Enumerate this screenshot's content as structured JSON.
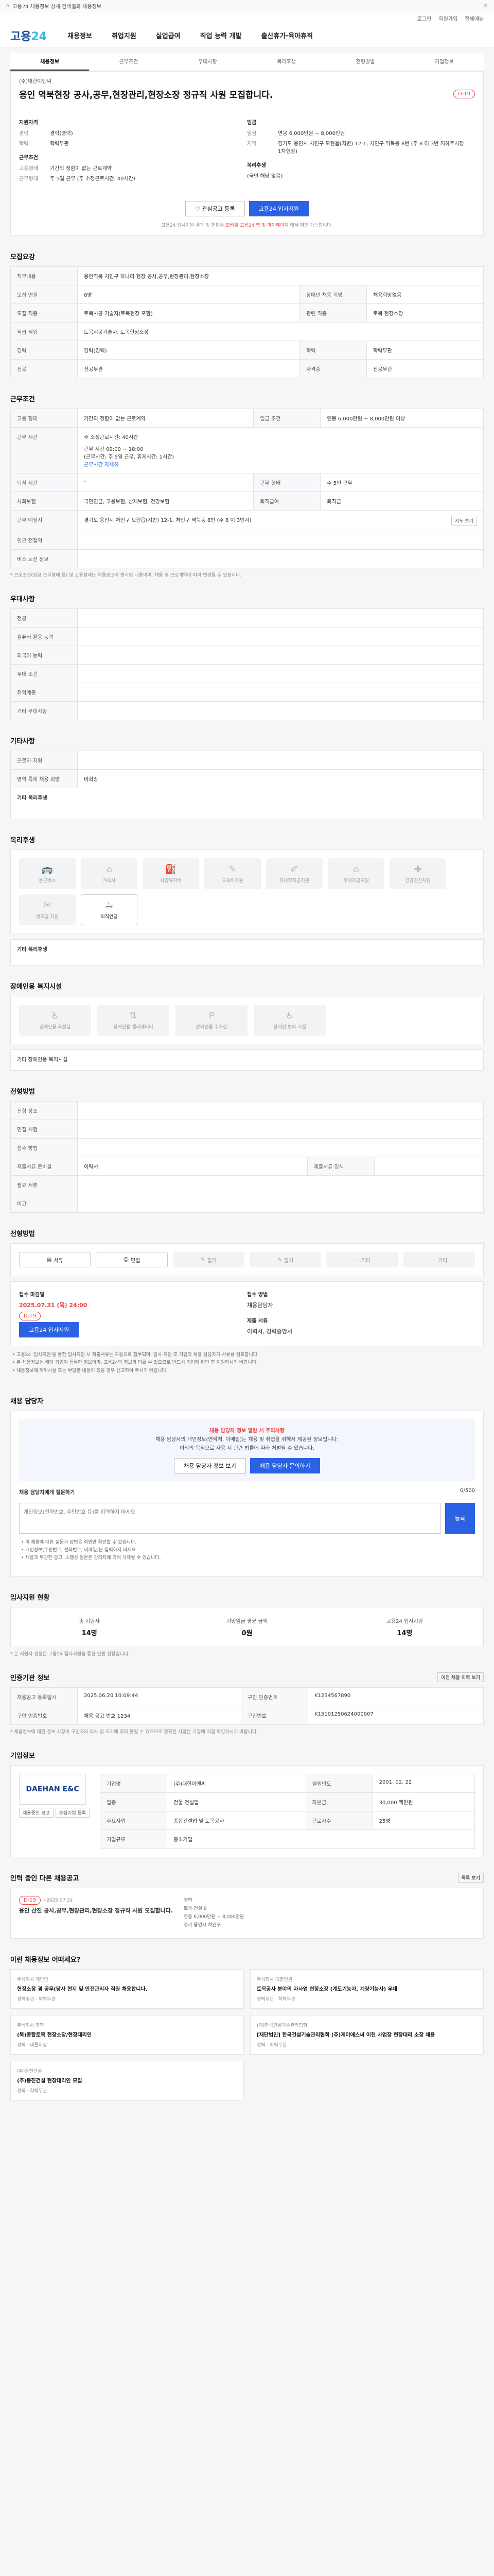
{
  "topbar": {
    "title": "고용24 채용정보 상세 검색결과 채용정보"
  },
  "util": {
    "links": [
      "로그인",
      "회원가입",
      "전체메뉴"
    ]
  },
  "header": {
    "logo_a": "고용",
    "logo_b": "24",
    "nav": [
      "채용정보",
      "취업지원",
      "실업급여",
      "직업 능력 개발",
      "출산휴가·육아휴직"
    ]
  },
  "tabs": [
    "채용정보",
    "근무조건",
    "우대사항",
    "복리후생",
    "전형방법",
    "기업정보"
  ],
  "job": {
    "company": "(주)대한이엔씨",
    "title": "용인 역북현장 공사,공무,현장관리,현장소장 정규직 사원 모집합니다.",
    "dday": "D-19",
    "qual_h": "지원자격",
    "qual": [
      {
        "k": "경력",
        "v": "경력(경력)"
      },
      {
        "k": "학력",
        "v": "학력무관"
      }
    ],
    "cond_h": "근무조건",
    "cond": [
      {
        "k": "고용형태",
        "v": "기간의 정함이 없는 근로계약"
      },
      {
        "k": "근무형태",
        "v": "주 5일 근무 (주 소정근로시간: 40시간)"
      }
    ],
    "pay_h": "임금",
    "pay": [
      {
        "k": "임금",
        "v": "연봉 6,000만원 ~ 8,000만원"
      },
      {
        "k": "지역",
        "v": "경기도 용인시 처인구 모현읍(지번) 12-1, 처인구 역북동 8번 (주 8 이 3번 지하주차장1차현장)"
      }
    ],
    "welfare_h": "복리후생",
    "welfare": "(국민 해당 없음)",
    "scrap": "♡ 관심공고 등록",
    "apply": "고용24 입사지원",
    "notice_a": "고용24 입사지원 결과 및 현황은",
    "notice_red": "모바일 고용24 앱 및 마이페이지",
    "notice_b": "에서 확인 가능합니다."
  },
  "sec": {
    "recruit": "모집요강",
    "cond": "근무조건",
    "pref": "우대사항",
    "etc": "기타사항",
    "welfare": "복리후생",
    "accessible": "장애인용 복지시설",
    "process": "전형방법",
    "contact": "채용 담당자",
    "stats": "입사지원 현황",
    "info": "인증기관 정보",
    "company": "기업정보",
    "related": "인력 중인 다른 채용공고",
    "recs": "이런 채용정보 어떠세요?"
  },
  "recruit": {
    "duty_h": "직무내용",
    "duty": "용인역북 처인구 하나리 현장 공사,공무,현장관리,현장소장",
    "rows": [
      {
        "k": "모집 인원",
        "v": "0명",
        "k2": "장애인 채용 희망",
        "v2": "채용희망없음"
      },
      {
        "k": "모집 직종",
        "v": "토목시공 기술자(토목현장 포함)",
        "k2": "관련 직종",
        "v2": "토목 현장소장"
      },
      {
        "k": "직급 직위",
        "v": "토목시공기술자, 토목현장소장",
        "k2": "",
        "v2": ""
      },
      {
        "k": "경력",
        "v": "경력(경력)",
        "k2": "학력",
        "v2": "학력무관"
      },
      {
        "k": "전공",
        "v": "전공무관",
        "k2": "자격증",
        "v2": "전공무관"
      }
    ]
  },
  "cond": {
    "rows1": [
      {
        "k": "고용 형태",
        "v": "기간의 정함이 없는 근로계약",
        "k2": "임금 조건",
        "v2": "연봉 6,000만원 ~ 8,000만원 이상"
      },
      {
        "k": "근무 시간",
        "v": "주 소정근로시간: 40시간",
        "k2": "",
        "v2": ""
      }
    ],
    "worktime_a": "근무 시간 09:00 ~ 18:00",
    "worktime_b": "(근무시간: 주 5일 근무, 휴게시간: 1시간)",
    "worktime_link": "근무시간 자세히",
    "rows2": [
      {
        "k": "퇴직 시간",
        "v": "-",
        "k2": "근무 형태",
        "v2": "주 5일 근무"
      },
      {
        "k": "사회보험",
        "v": "국민연금, 고용보험, 산재보험, 건강보험",
        "k2": "퇴직급여",
        "v2": "퇴직금"
      },
      {
        "k": "근무 예정지",
        "v": "경기도 용인시 처인구 모현읍(지번) 12-1, 처인구 역북동 8번 (주 8 이 3번지)",
        "k2": "",
        "v2": ""
      },
      {
        "k": "인근 전철역",
        "v": "",
        "k2": "",
        "v2": ""
      },
      {
        "k": "버스 노선 정보",
        "v": "",
        "k2": "",
        "v2": ""
      }
    ],
    "map_btn": "지도 보기",
    "note": "* 근로조건(임금 근무형태 등) 및 고용형태는 채용공고에 명시된 내용이며, 채용 후 근로계약에 따라 변경될 수 있습니다."
  },
  "pref": {
    "rows": [
      {
        "k": "전공",
        "v": ""
      },
      {
        "k": "컴퓨터 활용 능력",
        "v": ""
      },
      {
        "k": "외국어 능력",
        "v": ""
      },
      {
        "k": "우대 조건",
        "v": ""
      },
      {
        "k": "취약계층",
        "v": ""
      },
      {
        "k": "기타 우대사항",
        "v": ""
      }
    ]
  },
  "etc": {
    "rows": [
      {
        "k": "근로자 지원",
        "v": ""
      },
      {
        "k": "병역 특례 채용 희망",
        "v": "비희망"
      }
    ],
    "more_h": "기타 복리후생"
  },
  "welfare": {
    "items": [
      "통근버스",
      "기숙사",
      "차량유지비",
      "교육비지원",
      "자녀학자금지원",
      "주택자금지원",
      "건강검진지원",
      "경조금 지원",
      "퇴직연금"
    ],
    "on_index": 8,
    "more_h": "기타 복리후생"
  },
  "accessible": {
    "items": [
      "장애인용 화장실",
      "장애인용 엘리베이터",
      "장애인용 주차장",
      "장애인 편의 시설"
    ],
    "note": "기타 장애인용 복지시설"
  },
  "process": {
    "rows": [
      {
        "k": "전형 장소",
        "v": "",
        "k2": "",
        "v2": ""
      },
      {
        "k": "면접 시험",
        "v": "",
        "k2": "",
        "v2": ""
      },
      {
        "k": "접수 방법",
        "v": "",
        "k2": "",
        "v2": ""
      },
      {
        "k": "제출서류 준비물",
        "v": "이력서",
        "k2": "제출서류 양식",
        "v2": ""
      },
      {
        "k": "필요 서류",
        "v": "",
        "k2": "",
        "v2": ""
      },
      {
        "k": "비고",
        "v": "",
        "k2": "",
        "v2": ""
      }
    ]
  },
  "method": {
    "items": [
      "서류",
      "면접",
      "필기",
      "필기",
      "기타",
      "기타"
    ],
    "apply_h": "접수 마감일",
    "apply_date": "2025.07.31 (목) 24:00",
    "apply_dday": "D-19",
    "apply_btn": "고용24 입사지원",
    "how_h": "접수 방법",
    "how": "채용담당자",
    "docs_h": "제출 서류",
    "docs": "이력서, 경력증명서"
  },
  "bullets": [
    "• 고용24 '입사지원'을 통한 입사지원 시 제출서류는 자동으로 첨부되며, 입사 지원 후 기업의 채용 담당자가 서류를 검토합니다.",
    "• 본 채용정보는 해당 기업이 등록한 정보이며, 고용24의 정보와 다를 수 있으므로 반드시 기업에 확인 후 지원하시기 바랍니다.",
    "• 채용정보에 허위사실 또는 부당한 내용이 있을 경우 신고하여 주시기 바랍니다."
  ],
  "contact": {
    "banner_red": "채용 담당자 정보 열람 시 주의사항",
    "banner_a": "채용 담당자의 개인정보(연락처, 이메일)는 채용 및 취업을 위해서 제공된 정보입니다.",
    "banner_b": "이외의 목적으로 사용 시 관련 법률에 따라 처벌될 수 있습니다.",
    "btn_a": "채용 담당자 정보 보기",
    "btn_b": "채용 담당자 문의하기",
    "q_h": "채용 담당자에게 질문하기",
    "q_count": "0/500",
    "q_placeholder": "개인정보(전화번호, 주민번호 등)를 입력하지 마세요.",
    "q_btn": "등록",
    "notes": [
      "• 이 채용에 대한 질문과 답변은 회원만 확인할 수 있습니다.",
      "• 개인정보(주민번호, 전화번호, 이메일)는 입력하지 마세요.",
      "• 채용과 무관한 광고, 스팸성 질문은 관리자에 의해 삭제될 수 있습니다."
    ]
  },
  "stats": {
    "items": [
      {
        "l": "총 지원자",
        "n": "14명"
      },
      {
        "l": "희망임금 평균 금액",
        "n": "0원"
      },
      {
        "l": "고용24 입사지원",
        "n": "14명"
      }
    ],
    "note": "* 본 지원자 현황은 고용24 입사지원을 통한 인원 현황입니다."
  },
  "info": {
    "rows": [
      {
        "k": "채용공고 등록일시",
        "v": "2025.06.20 10:09:44",
        "k2": "구인 인증번호",
        "v2": "K1234567890"
      },
      {
        "k": "구인 인증번호",
        "v": "채용 공고 번호 1234",
        "k2": "구인번호",
        "v2": "K15101250624000007"
      }
    ],
    "link": "이전 채용 이력 보기",
    "note": "* 채용정보에 대한 정보 사항이 구인자의 의사 및 오기에 따라 틀릴 수 있으므로 정확한 사항은 기업에 직접 확인하시기 바랍니다."
  },
  "company": {
    "logo": "DAEHAN E&C",
    "name": "(주)대한이엔씨",
    "rows": [
      {
        "k": "기업명",
        "v": "(주)대한이엔씨",
        "k2": "설립년도",
        "v2": "2001. 02. 22"
      },
      {
        "k": "업종",
        "v": "건물 건설업",
        "k2": "자본금",
        "v2": "30,000 백만원"
      },
      {
        "k": "주요사업",
        "v": "종합건설업 및 토목공사",
        "k2": "근로자수",
        "v2": "25명"
      },
      {
        "k": "기업규모",
        "v": "중소기업",
        "k2": "",
        "v2": ""
      }
    ],
    "btn_a": "채용중인 공고",
    "btn_b": "관심기업 등록"
  },
  "related": {
    "dday": "D-19",
    "date": "~2025.07.31",
    "title": "용인 산진 공사,공무,현장관리,현장소장 정규직 사원 모집합니다.",
    "meta": [
      "경력",
      "토목·건설 8",
      "연봉 6,000만원 ~ 8,000만원",
      "경기 용인시 처인구"
    ],
    "more": "목록 보기"
  },
  "recs": [
    {
      "co": "주식회사 개인인",
      "t": "현장소장 경 공무(당사 현지 및 안전관리자 직원 채용합니다.",
      "m": "경력무관 · 학력무관"
    },
    {
      "co": "주식회사 대한인원",
      "t": "토목공사 분야의 자사업 현장소장 (계도기능자, 계량기능사) 우대",
      "m": "경력무관 · 학력무관"
    },
    {
      "co": "주식회사 영진",
      "t": "(복)종합토목 현장소장/현장대리인",
      "m": "경력 · 대졸이상"
    },
    {
      "co": "(재)한국건설기술관리협회",
      "t": "[재단법인] 한국건설기술관리협회 (주)제이에스씨 이천 사업장 현장대리 소장 채용",
      "m": "경력 · 학력무관"
    },
    {
      "co": "(주)동진건설",
      "t": "(주)동진건설 현장대리인 모집",
      "m": "경력 · 학력무관"
    }
  ]
}
